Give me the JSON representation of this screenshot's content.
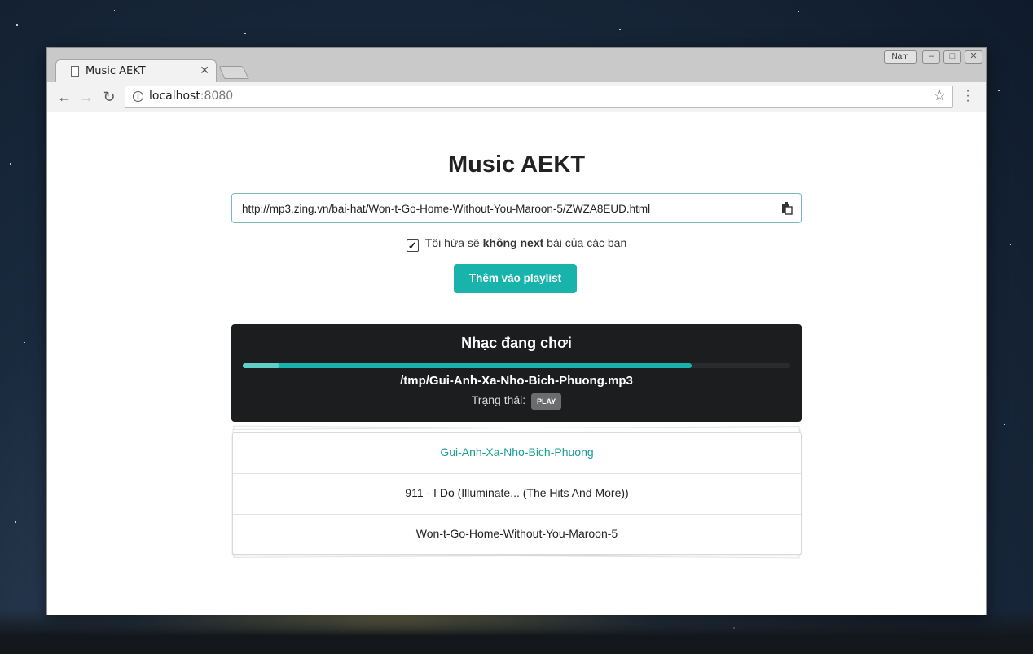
{
  "browser": {
    "tab_title": "Music AEKT",
    "profile_name": "Nam",
    "url_host": "localhost",
    "url_port": ":8080"
  },
  "page": {
    "title": "Music AEKT",
    "url_input_value": "http://mp3.zing.vn/bai-hat/Won-t-Go-Home-Without-You-Maroon-5/ZWZA8EUD.html",
    "promise_prefix": "Tôi hứa sẽ ",
    "promise_bold": "không next",
    "promise_suffix": " bài của các bạn",
    "promise_checked": true,
    "add_button": "Thêm vào playlist"
  },
  "player": {
    "title": "Nhạc đang chơi",
    "progress_fraction": 0.82,
    "file": "/tmp/Gui-Anh-Xa-Nho-Bich-Phuong.mp3",
    "status_label": "Trạng thái:",
    "status_badge": "PLAY",
    "accent_color": "#18b3aa"
  },
  "playlist": [
    {
      "title": "Gui-Anh-Xa-Nho-Bich-Phuong",
      "active": true
    },
    {
      "title": "911 - I Do (Illuminate... (The Hits And More))",
      "active": false
    },
    {
      "title": "Won-t-Go-Home-Without-You-Maroon-5",
      "active": false
    }
  ]
}
